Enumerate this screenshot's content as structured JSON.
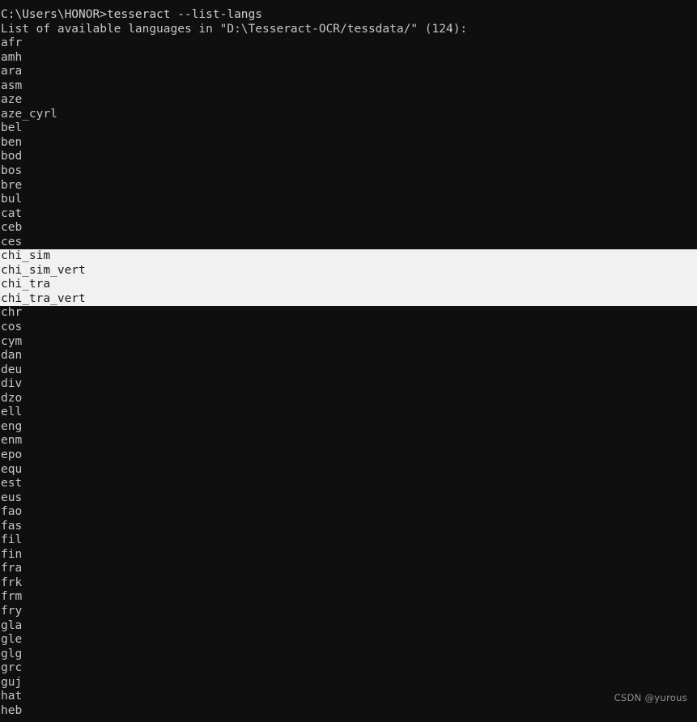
{
  "window": {
    "title": "Command Prompt",
    "background_color": "#0f0f10",
    "text_color": "#c8c6c2",
    "selection_background_color": "#f1f1f1",
    "selection_text_color": "#1c1c1c"
  },
  "terminal": {
    "prompt_line": "C:\\Users\\HONOR>tesseract --list-langs",
    "output_header": "List of available languages in \"D:\\Tesseract-OCR/tessdata/\" (124):",
    "prompt_path": "C:\\Users\\HONOR",
    "prompt_symbol": ">",
    "command": "tesseract --list-langs",
    "tessdata_path": "D:\\Tesseract-OCR/tessdata/",
    "language_count": "124",
    "languages": [
      "afr",
      "amh",
      "ara",
      "asm",
      "aze",
      "aze_cyrl",
      "bel",
      "ben",
      "bod",
      "bos",
      "bre",
      "bul",
      "cat",
      "ceb",
      "ces",
      "chi_sim",
      "chi_sim_vert",
      "chi_tra",
      "chi_tra_vert",
      "chr",
      "cos",
      "cym",
      "dan",
      "deu",
      "div",
      "dzo",
      "ell",
      "eng",
      "enm",
      "epo",
      "equ",
      "est",
      "eus",
      "fao",
      "fas",
      "fil",
      "fin",
      "fra",
      "frk",
      "frm",
      "fry",
      "gla",
      "gle",
      "glg",
      "grc",
      "guj",
      "hat",
      "heb"
    ],
    "selected_languages": [
      "chi_sim",
      "chi_sim_vert",
      "chi_tra",
      "chi_tra_vert"
    ]
  },
  "watermark": {
    "text": "CSDN @yurous"
  }
}
